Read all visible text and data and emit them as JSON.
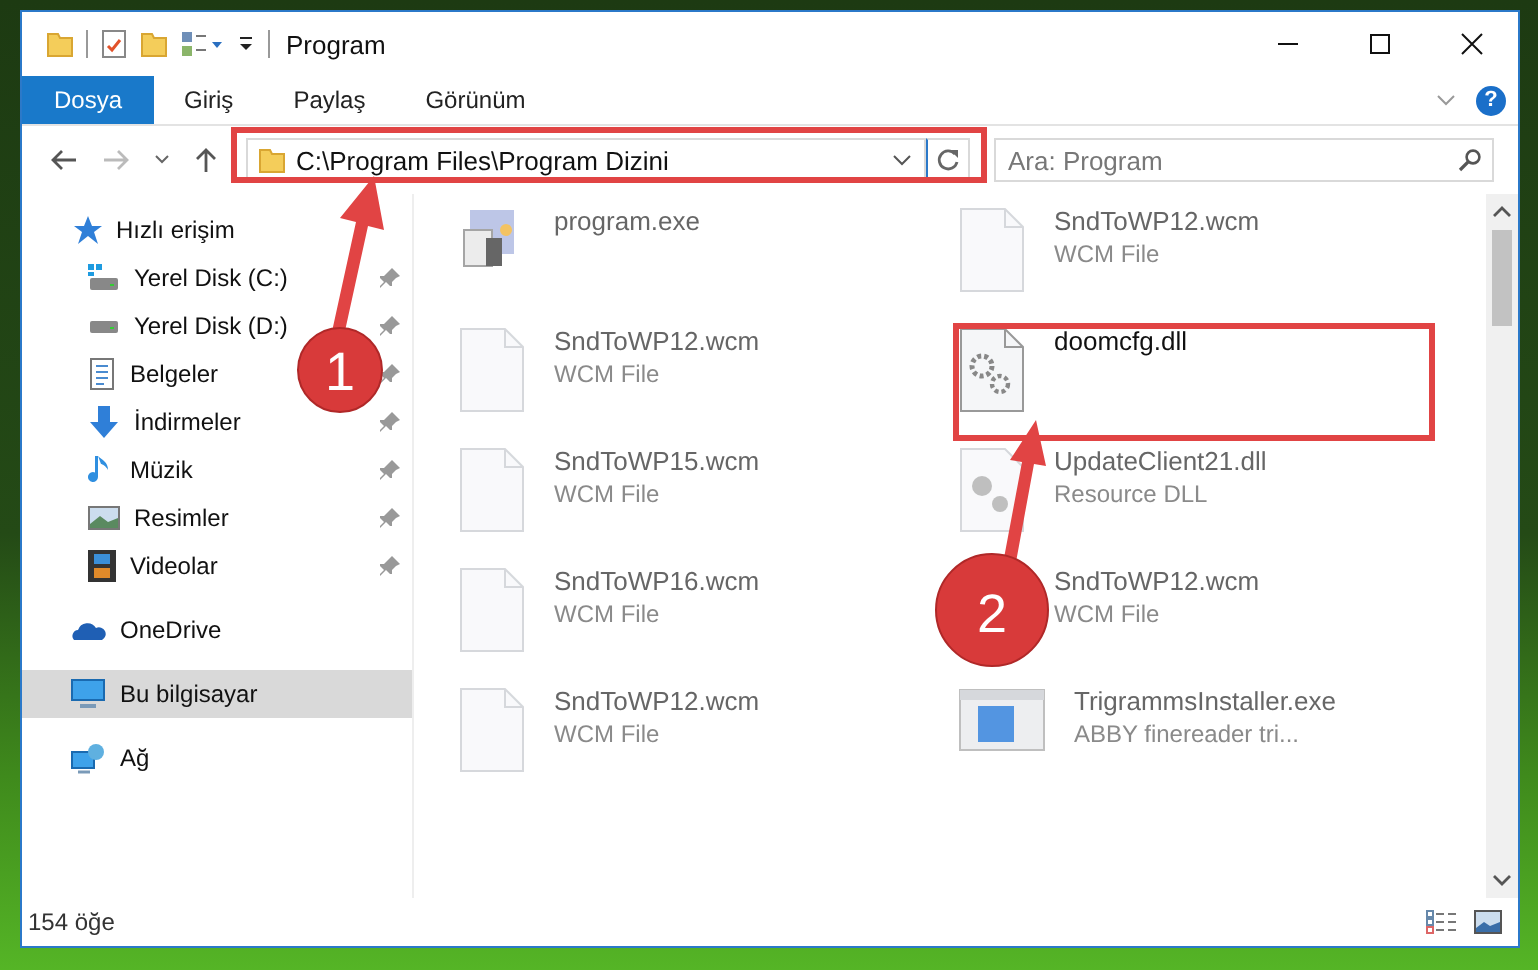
{
  "window": {
    "title": "Program"
  },
  "ribbon_tabs": [
    {
      "label": "Dosya",
      "selected": true
    },
    {
      "label": "Giriş",
      "selected": false
    },
    {
      "label": "Paylaş",
      "selected": false
    },
    {
      "label": "Görünüm",
      "selected": false
    }
  ],
  "help": "?",
  "address": {
    "value": "C:\\Program Files\\Program Dizini"
  },
  "search": {
    "placeholder": "Ara: Program"
  },
  "nav": [
    {
      "label": "Hızlı erişim",
      "kind": "star",
      "selected": false,
      "children": [
        {
          "label": "Yerel Disk (C:)",
          "kind": "drive-win",
          "selected": false,
          "pinned": true
        },
        {
          "label": "Yerel Disk (D:)",
          "kind": "drive",
          "selected": false,
          "pinned": true
        },
        {
          "label": "Belgeler",
          "kind": "docs",
          "selected": false,
          "pinned": true
        },
        {
          "label": "İndirmeler",
          "kind": "download",
          "selected": false,
          "pinned": true
        },
        {
          "label": "Müzik",
          "kind": "music",
          "selected": false,
          "pinned": true
        },
        {
          "label": "Resimler",
          "kind": "pictures",
          "selected": false,
          "pinned": true
        },
        {
          "label": "Videolar",
          "kind": "video",
          "selected": false,
          "pinned": true
        }
      ]
    },
    {
      "label": "OneDrive",
      "kind": "cloud",
      "selected": false
    },
    {
      "label": "Bu bilgisayar",
      "kind": "pc",
      "selected": true
    },
    {
      "label": "Ağ",
      "kind": "network",
      "selected": false
    }
  ],
  "files": [
    {
      "name": "program.exe",
      "kind": "app",
      "blurred": true
    },
    {
      "name": "SndToWP12.wcm",
      "type": "WCM File",
      "kind": "file",
      "blurred": true
    },
    {
      "name": "SndToWP12.wcm",
      "type": "WCM File",
      "kind": "file",
      "blurred": true
    },
    {
      "name": "doomcfg.dll",
      "kind": "gear",
      "blurred": false
    },
    {
      "name": "SndToWP15.wcm",
      "type": "WCM File",
      "kind": "file",
      "blurred": true
    },
    {
      "name": "UpdateClient21.dll",
      "type": "Resource DLL",
      "kind": "dll",
      "blurred": true
    },
    {
      "name": "SndToWP16.wcm",
      "type": "WCM File",
      "kind": "file",
      "blurred": true
    },
    {
      "name": "SndToWP12.wcm",
      "type": "WCM File",
      "blurred": true
    },
    {
      "name": "SndToWP12.wcm",
      "type": "WCM File",
      "kind": "file",
      "blurred": true
    },
    {
      "name": "TrigrammsInstaller.exe",
      "type": "ABBY finereader tri...",
      "kind": "installer",
      "blurred": true
    }
  ],
  "status_bar": {
    "count": "154 öğe"
  },
  "callouts": [
    {
      "number": "1"
    },
    {
      "number": "2"
    }
  ]
}
